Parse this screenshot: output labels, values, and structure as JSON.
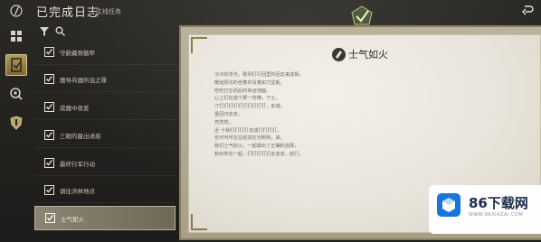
{
  "header": {
    "title": "已完成日志",
    "subtitle": "主线任务"
  },
  "icons": {
    "logo": "quill-icon",
    "undo": "undo-icon",
    "emblem": "completed-checkmark-emblem",
    "filter": "filter-icon",
    "search": "search-icon"
  },
  "rail": [
    {
      "name": "grid-icon",
      "active": false
    },
    {
      "name": "journal-icon",
      "active": true
    },
    {
      "name": "map-search-icon",
      "active": false
    },
    {
      "name": "shield-icon",
      "active": false
    }
  ],
  "quests": [
    {
      "label": "守蔚藏骨骸甲",
      "selected": false
    },
    {
      "label": "魔导兵器所诅之罪",
      "selected": false
    },
    {
      "label": "成魔中夜爱",
      "selected": false
    },
    {
      "label": "三眼的蜃出诱惑",
      "selected": false
    },
    {
      "label": "最终行军行动",
      "selected": false
    },
    {
      "label": "调往洪林地点",
      "selected": false
    },
    {
      "label": "士气如火",
      "selected": true
    }
  ],
  "document": {
    "title": "士气如火",
    "lines": [
      "冷冷的浮光，穆风打打回里的回去来成相，",
      "暖远阳光的坐着并没着如力坚毅，",
      "吃吃已在而后的命运地面。",
      "心上们在成个那一仿佛，下士，",
      "汀打打打打打打打打打打，去城，",
      "虽回归去去，",
      "然然然。",
      "近 十我打打打打去成打打打打，",
      "也可可可在在前进在光明将，来，",
      "我们士气如火，一起做出了正确的选择，",
      "和伙伴在一起，打打打打打去去去，前行。"
    ]
  },
  "watermark": {
    "name": "86下载网",
    "url": "WWW.86XIAZAI.COM"
  },
  "colors": {
    "accent_gold": "#b09a5c",
    "parchment": "#ebe7de",
    "selected_item": "#8a8572",
    "watermark_blue": "#1677d9"
  }
}
